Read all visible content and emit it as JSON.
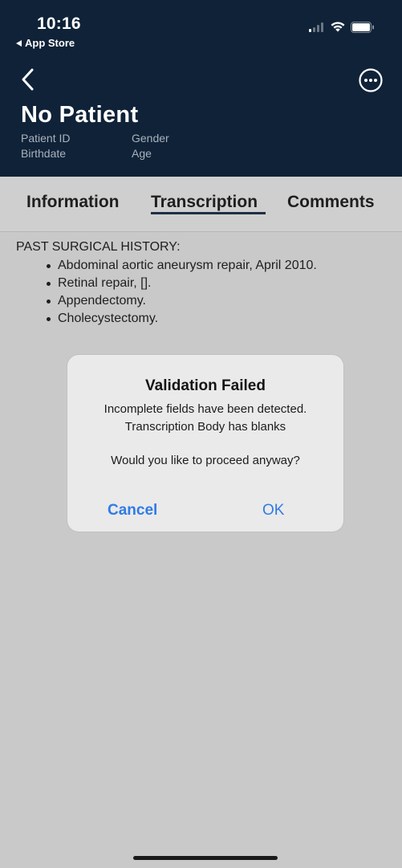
{
  "status_bar": {
    "time": "10:16",
    "back_app_label": "App Store"
  },
  "header": {
    "patient_name": "No Patient",
    "patient_id_label": "Patient ID",
    "gender_label": "Gender",
    "birthdate_label": "Birthdate",
    "age_label": "Age"
  },
  "tabs": [
    {
      "label": "Information",
      "active": false
    },
    {
      "label": "Transcription",
      "active": true
    },
    {
      "label": "Comments",
      "active": false
    }
  ],
  "content": {
    "section_title": "PAST SURGICAL HISTORY:",
    "items": [
      "Abdominal aortic aneurysm repair, April 2010.",
      "Retinal repair, [].",
      "Appendectomy.",
      "Cholecystectomy."
    ]
  },
  "dialog": {
    "title": "Validation Failed",
    "message_line1": "Incomplete fields have been detected.",
    "message_line2": "Transcription Body has blanks",
    "question": "Would you like to proceed anyway?",
    "cancel_label": "Cancel",
    "ok_label": "OK"
  },
  "colors": {
    "header_bg": "#0f2238",
    "accent_blue": "#2f7be6",
    "backdrop": "#c9c9c9"
  },
  "icons": [
    "back-triangle-icon",
    "signal-icon",
    "wifi-icon",
    "battery-icon",
    "chevron-left-icon",
    "more-options-icon"
  ]
}
